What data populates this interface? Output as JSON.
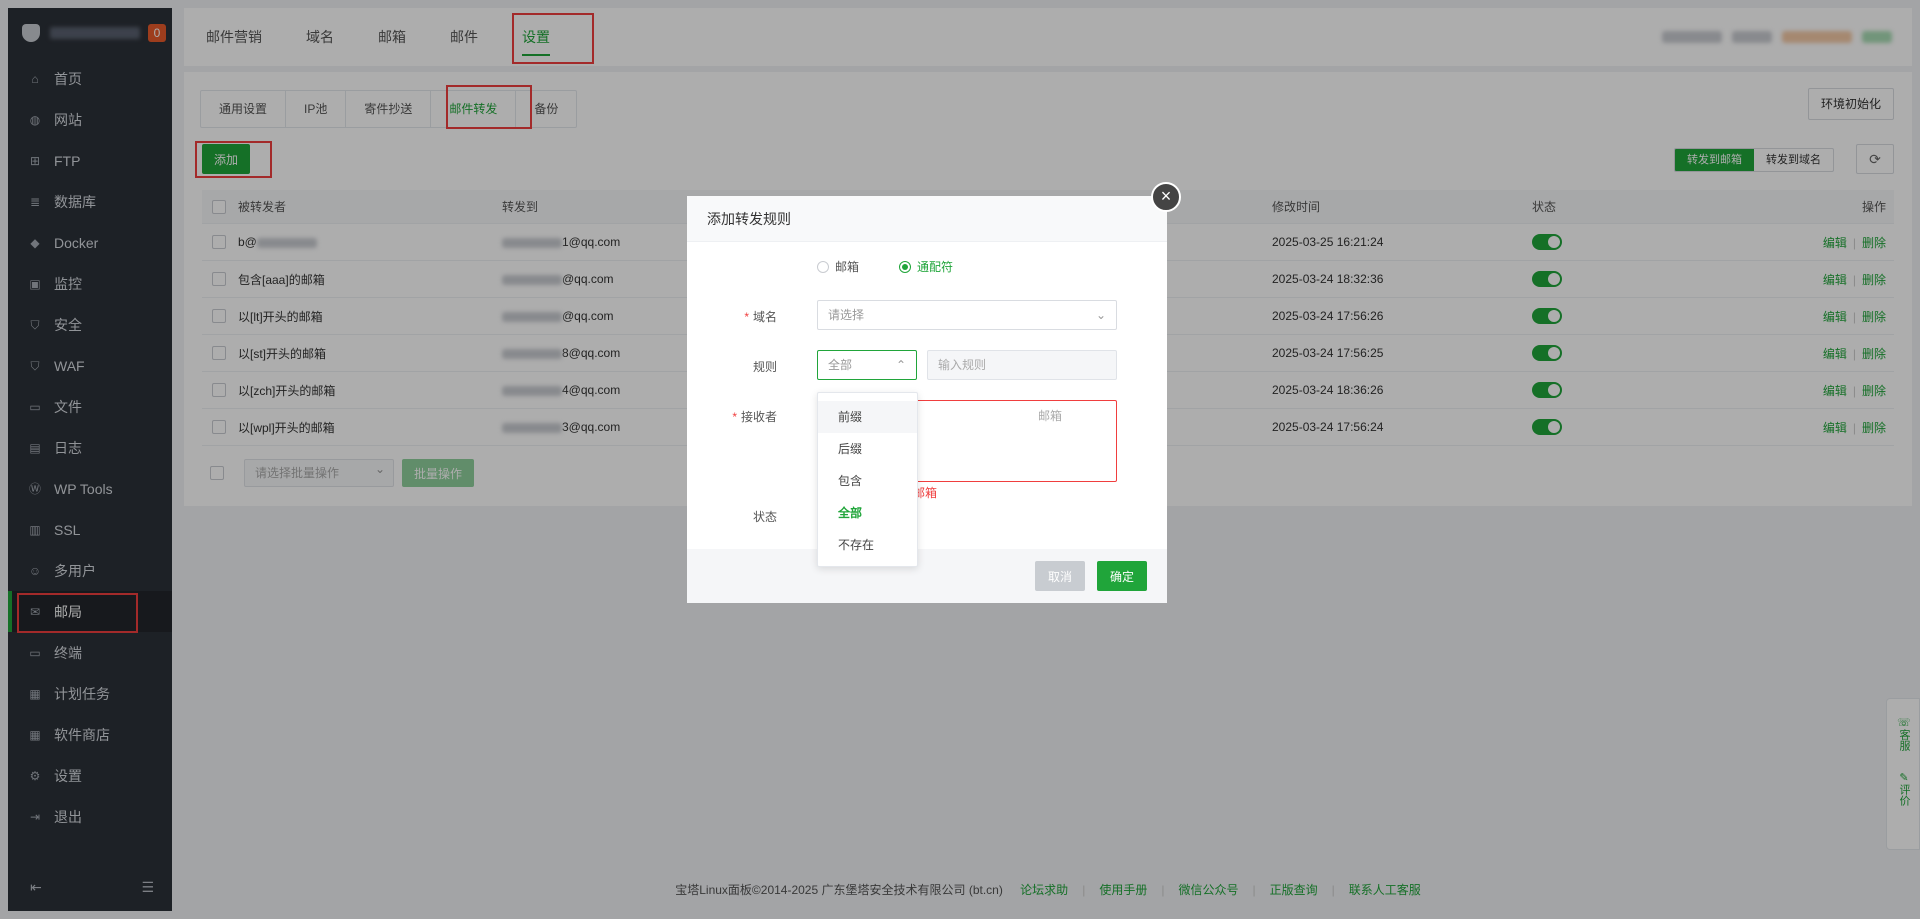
{
  "sidebar": {
    "badge": "0",
    "items": [
      {
        "label": "首页",
        "icon": "home-icon",
        "glyph": "⌂"
      },
      {
        "label": "网站",
        "icon": "globe-icon",
        "glyph": "◍"
      },
      {
        "label": "FTP",
        "icon": "ftp-icon",
        "glyph": "⊞"
      },
      {
        "label": "数据库",
        "icon": "database-icon",
        "glyph": "≣"
      },
      {
        "label": "Docker",
        "icon": "docker-icon",
        "glyph": "◆"
      },
      {
        "label": "监控",
        "icon": "monitor-icon",
        "glyph": "▣"
      },
      {
        "label": "安全",
        "icon": "shield-icon",
        "glyph": "⛉"
      },
      {
        "label": "WAF",
        "icon": "waf-icon",
        "glyph": "⛉"
      },
      {
        "label": "文件",
        "icon": "folder-icon",
        "glyph": "▭"
      },
      {
        "label": "日志",
        "icon": "log-icon",
        "glyph": "▤"
      },
      {
        "label": "WP Tools",
        "icon": "wordpress-icon",
        "glyph": "Ⓦ"
      },
      {
        "label": "SSL",
        "icon": "ssl-icon",
        "glyph": "▥"
      },
      {
        "label": "多用户",
        "icon": "users-icon",
        "glyph": "☺"
      },
      {
        "label": "邮局",
        "icon": "mail-icon",
        "glyph": "✉"
      },
      {
        "label": "终端",
        "icon": "terminal-icon",
        "glyph": "▭"
      },
      {
        "label": "计划任务",
        "icon": "calendar-icon",
        "glyph": "▦"
      },
      {
        "label": "软件商店",
        "icon": "store-icon",
        "glyph": "▦"
      },
      {
        "label": "设置",
        "icon": "gear-icon",
        "glyph": "⚙"
      },
      {
        "label": "退出",
        "icon": "logout-icon",
        "glyph": "⇥"
      }
    ],
    "active_index": 13
  },
  "topnav": {
    "tabs": [
      "邮件营销",
      "域名",
      "邮箱",
      "邮件",
      "设置"
    ],
    "active": 4
  },
  "subtabs": {
    "items": [
      "通用设置",
      "IP池",
      "寄件抄送",
      "邮件转发",
      "备份"
    ],
    "active": 3
  },
  "toolbar": {
    "env_init": "环境初始化",
    "add": "添加",
    "seg_mailbox": "转发到邮箱",
    "seg_domain": "转发到域名",
    "refresh_glyph": "⟳"
  },
  "table": {
    "headers": {
      "forwarded_from": "被转发者",
      "forward_to": "转发到",
      "modified": "修改时间",
      "status": "状态",
      "actions": "操作"
    },
    "action_edit": "编辑",
    "action_delete": "删除",
    "rows": [
      {
        "from": "b@",
        "to": "1@qq.com",
        "time": "2025-03-25 16:21:24"
      },
      {
        "from": "包含[aaa]的邮箱",
        "to": "@qq.com",
        "time": "2025-03-24 18:32:36"
      },
      {
        "from": "以[lt]开头的邮箱",
        "to": "@qq.com",
        "time": "2025-03-24 17:56:26"
      },
      {
        "from": "以[st]开头的邮箱",
        "to": "8@qq.com",
        "time": "2025-03-24 17:56:25"
      },
      {
        "from": "以[zch]开头的邮箱",
        "to": "4@qq.com",
        "time": "2025-03-24 18:36:26"
      },
      {
        "from": "以[wpl]开头的邮箱",
        "to": "3@qq.com",
        "time": "2025-03-24 17:56:24"
      }
    ]
  },
  "bulk": {
    "placeholder": "请选择批量操作",
    "button": "批量操作"
  },
  "footer": {
    "copyright": "宝塔Linux面板©2014-2025 广东堡塔安全技术有限公司 (bt.cn)",
    "links": [
      "论坛求助",
      "使用手册",
      "微信公众号",
      "正版查询",
      "联系人工客服"
    ]
  },
  "float": {
    "service": "客服",
    "review": "评价"
  },
  "modal": {
    "title": "添加转发规则",
    "radio_mailbox": "邮箱",
    "radio_wildcard": "通配符",
    "domain_label": "域名",
    "domain_placeholder": "请选择",
    "rule_label": "规则",
    "rule_value": "全部",
    "rule_input_placeholder": "输入规则",
    "receiver_label": "接收者",
    "receiver_placeholder_tail": "邮箱",
    "error_tail": "邮箱",
    "status_label": "状态",
    "cancel": "取消",
    "confirm": "确定"
  },
  "dropdown": {
    "options": [
      "前缀",
      "后缀",
      "包含",
      "全部",
      "不存在"
    ],
    "selected": 3,
    "hovered": 0
  },
  "colors": {
    "accent": "#20a53a",
    "danger": "#f03e3e",
    "sidebar_bg": "#2c3138"
  }
}
